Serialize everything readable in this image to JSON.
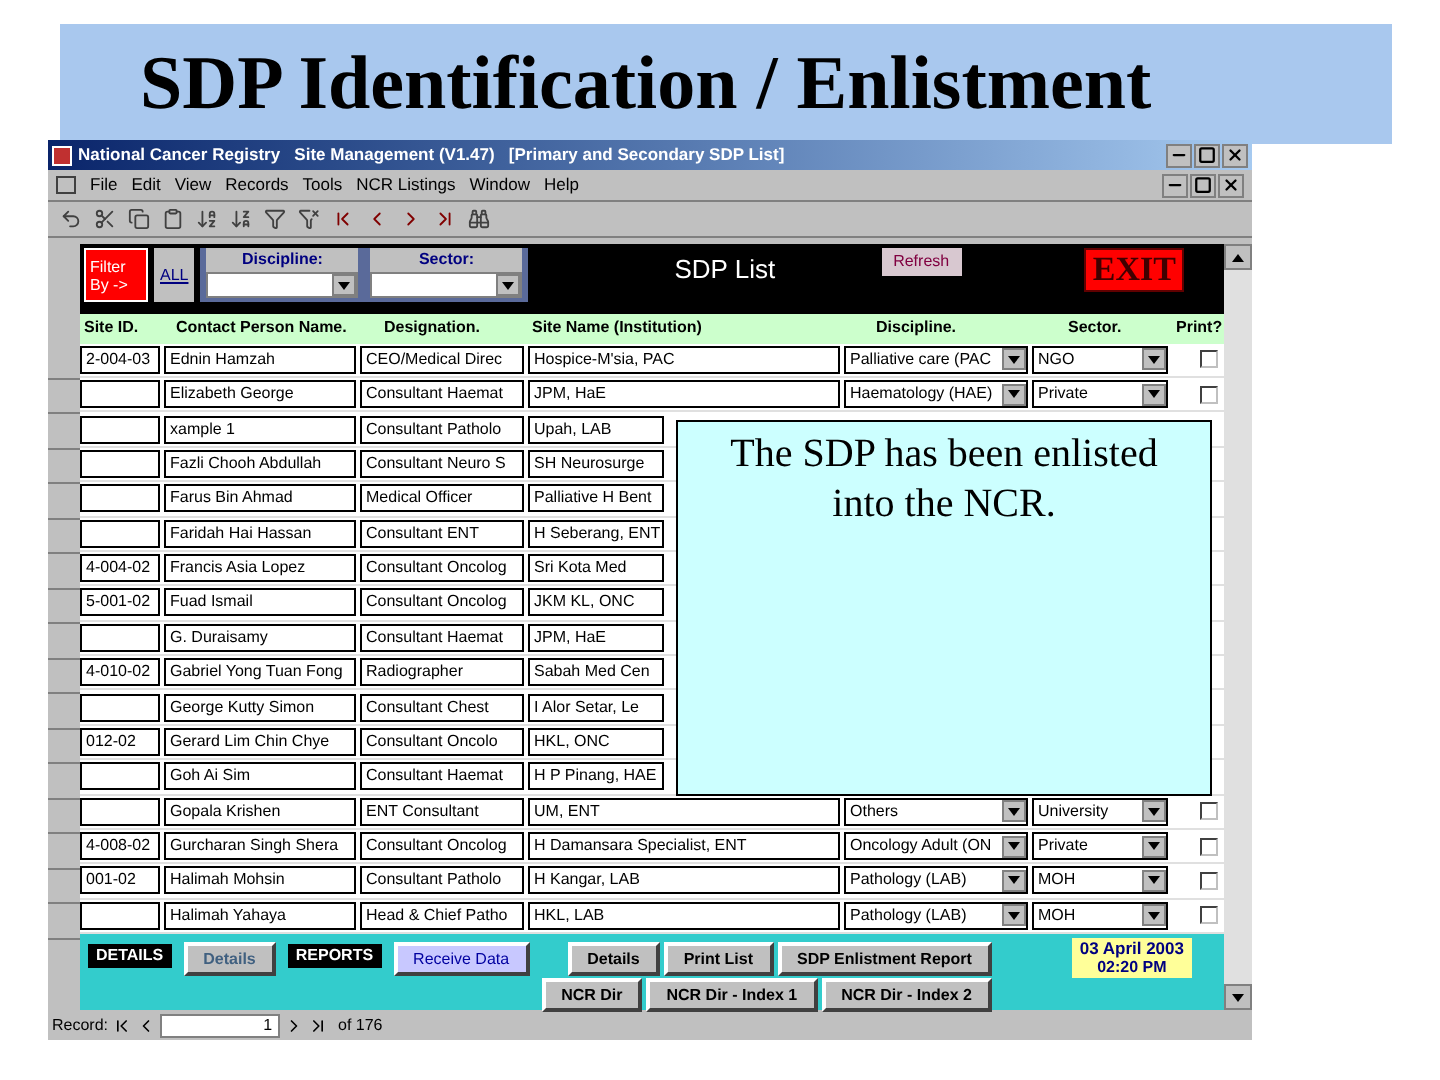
{
  "slide_title": "SDP Identification / Enlistment",
  "window": {
    "title": "National Cancer Registry   Site Management (V1.47)   [Primary and Secondary SDP List]"
  },
  "menu": [
    "File",
    "Edit",
    "View",
    "Records",
    "Tools",
    "NCR Listings",
    "Window",
    "Help"
  ],
  "header": {
    "filter_button": "Filter By ->",
    "all_button": "ALL",
    "discipline_label": "Discipline:",
    "sector_label": "Sector:",
    "title": "SDP List",
    "refresh_button": "Refresh",
    "exit_button": "EXIT"
  },
  "columns": [
    "Site ID.",
    "Contact Person Name.",
    "Designation.",
    "Site Name (Institution)",
    "Discipline.",
    "Sector.",
    "Print?"
  ],
  "rows": [
    {
      "site_id": "2-004-03",
      "contact": "Ednin Hamzah",
      "designation": "CEO/Medical Direc",
      "site_name": "Hospice-M'sia, PAC",
      "discipline": "Palliative care (PAC",
      "sector": "NGO",
      "print_checked": false
    },
    {
      "contact": "Elizabeth George",
      "designation": "Consultant Haemat",
      "site_name": "JPM, HaE",
      "discipline": "Haematology (HAE)",
      "sector": "Private",
      "print_checked": false
    },
    {
      "contact": "xample 1",
      "designation": "Consultant Patholo",
      "site_name": "Upah, LAB"
    },
    {
      "contact": "Fazli Chooh Abdullah",
      "designation": "Consultant Neuro S",
      "site_name": "SH Neurosurge"
    },
    {
      "contact": "Farus Bin Ahmad",
      "designation": "Medical Officer",
      "site_name": "Palliative H Bent"
    },
    {
      "contact": "Faridah Hai Hassan",
      "designation": "Consultant ENT",
      "site_name": "H Seberang, ENT"
    },
    {
      "site_id": "4-004-02",
      "contact": "Francis Asia Lopez",
      "designation": "Consultant Oncolog",
      "site_name": "Sri Kota Med"
    },
    {
      "site_id": "5-001-02",
      "contact": "Fuad Ismail",
      "designation": "Consultant Oncolog",
      "site_name": "JKM KL, ONC"
    },
    {
      "contact": "G. Duraisamy",
      "designation": "Consultant Haemat",
      "site_name": "JPM, HaE"
    },
    {
      "site_id": "4-010-02",
      "contact": "Gabriel Yong Tuan Fong",
      "designation": "Radiographer",
      "site_name": "Sabah Med Cen"
    },
    {
      "contact": "George Kutty Simon",
      "designation": "Consultant Chest",
      "site_name": "I Alor Setar, Le"
    },
    {
      "site_id": "012-02",
      "contact": "Gerard Lim Chin Chye",
      "designation": "Consultant Oncolo",
      "site_name": "HKL, ONC"
    },
    {
      "contact": "Goh Ai Sim",
      "designation": "Consultant Haemat",
      "site_name": "H P Pinang, HAE"
    },
    {
      "contact": "Gopala Krishen",
      "designation": "ENT Consultant",
      "site_name": "UM, ENT",
      "discipline": "Others",
      "sector": "University",
      "print_checked": false
    },
    {
      "site_id": "4-008-02",
      "contact": "Gurcharan Singh Shera",
      "designation": "Consultant Oncolog",
      "site_name": "H Damansara Specialist, ENT",
      "discipline": "Oncology Adult (ON",
      "sector": "Private",
      "print_checked": false
    },
    {
      "site_id": "001-02",
      "contact": "Halimah Mohsin",
      "designation": "Consultant Patholo",
      "site_name": "H Kangar, LAB",
      "discipline": "Pathology (LAB)",
      "sector": "MOH",
      "print_checked": false
    },
    {
      "contact": "Halimah Yahaya",
      "designation": "Head & Chief Patho",
      "site_name": "HKL, LAB",
      "discipline": "Pathology (LAB)",
      "sector": "MOH",
      "print_checked": false
    }
  ],
  "popup": {
    "text": "The SDP has been enlisted into the NCR."
  },
  "footer": {
    "details_label": "DETAILS",
    "details_button": "Details",
    "reports_label": "REPORTS",
    "receive_button": "Receive Data",
    "report_buttons": [
      "Details",
      "Print List",
      "SDP Enlistment Report"
    ],
    "directory_buttons": [
      "NCR Dir",
      "NCR Dir - Index 1",
      "NCR Dir - Index 2"
    ],
    "date": "03 April 2003",
    "time": "02:20 PM"
  },
  "record_nav": {
    "label": "Record:",
    "current": "1",
    "total": "of 176"
  }
}
